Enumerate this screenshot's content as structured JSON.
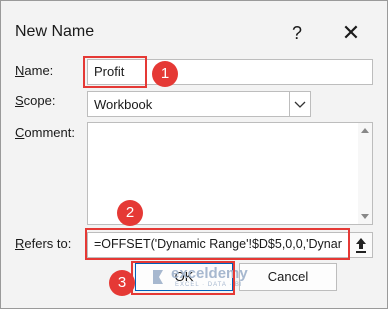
{
  "dialog": {
    "title": "New Name",
    "help_glyph": "?",
    "close_glyph": "✕"
  },
  "form": {
    "name_label_access": "N",
    "name_label_rest": "ame:",
    "name_value": "Profit",
    "scope_label_access": "S",
    "scope_label_rest": "cope:",
    "scope_value": "Workbook",
    "comment_label_access": "C",
    "comment_label_rest": "omment:",
    "comment_value": "",
    "refers_label_access": "R",
    "refers_label_rest": "efers to:",
    "refers_value": "=OFFSET('Dynamic Range'!$D$5,0,0,'Dynar"
  },
  "buttons": {
    "ok": "OK",
    "cancel": "Cancel"
  },
  "annotations": {
    "badge1": "1",
    "badge2": "2",
    "badge3": "3",
    "highlight_color": "#e53935"
  },
  "watermark": {
    "brand": "exceldemy",
    "tagline": "EXCEL · DATA · BI"
  }
}
